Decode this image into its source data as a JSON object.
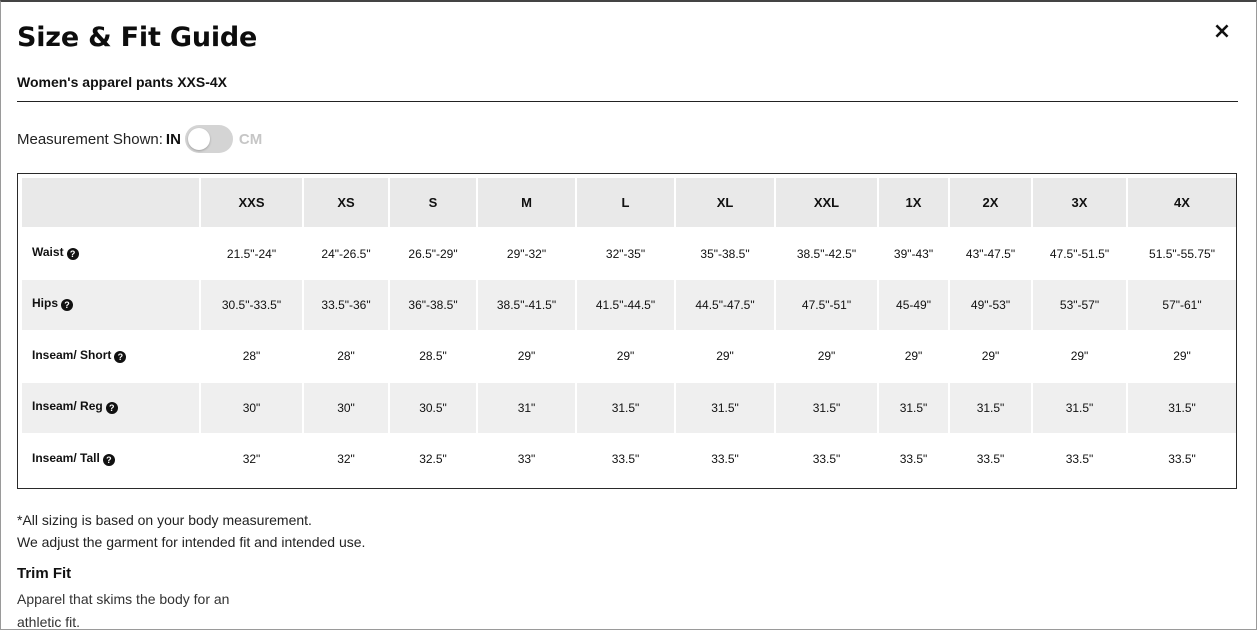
{
  "modal": {
    "title": "Size & Fit Guide",
    "close_icon": "×",
    "subtitle": "Women's apparel pants XXS-4X"
  },
  "measurement": {
    "label": "Measurement Shown:",
    "unit_in": "IN",
    "unit_cm": "CM",
    "selected": "IN"
  },
  "size_table": {
    "sizes": [
      "XXS",
      "XS",
      "S",
      "M",
      "L",
      "XL",
      "XXL",
      "1X",
      "2X",
      "3X",
      "4X"
    ],
    "rows": [
      {
        "label": "Waist",
        "values": [
          "21.5\"-24\"",
          "24\"-26.5\"",
          "26.5\"-29\"",
          "29\"-32\"",
          "32\"-35\"",
          "35\"-38.5\"",
          "38.5\"-42.5\"",
          "39\"-43\"",
          "43\"-47.5\"",
          "47.5\"-51.5\"",
          "51.5\"-55.75\""
        ]
      },
      {
        "label": "Hips",
        "values": [
          "30.5\"-33.5\"",
          "33.5\"-36\"",
          "36\"-38.5\"",
          "38.5\"-41.5\"",
          "41.5\"-44.5\"",
          "44.5\"-47.5\"",
          "47.5\"-51\"",
          "45-49\"",
          "49\"-53\"",
          "53\"-57\"",
          "57\"-61\""
        ]
      },
      {
        "label": "Inseam/ Short",
        "values": [
          "28\"",
          "28\"",
          "28.5\"",
          "29\"",
          "29\"",
          "29\"",
          "29\"",
          "29\"",
          "29\"",
          "29\"",
          "29\""
        ]
      },
      {
        "label": "Inseam/ Reg",
        "values": [
          "30\"",
          "30\"",
          "30.5\"",
          "31\"",
          "31.5\"",
          "31.5\"",
          "31.5\"",
          "31.5\"",
          "31.5\"",
          "31.5\"",
          "31.5\""
        ]
      },
      {
        "label": "Inseam/ Tall",
        "values": [
          "32\"",
          "32\"",
          "32.5\"",
          "33\"",
          "33.5\"",
          "33.5\"",
          "33.5\"",
          "33.5\"",
          "33.5\"",
          "33.5\"",
          "33.5\""
        ]
      }
    ]
  },
  "footnote": {
    "line1": "*All sizing is based on your body measurement.",
    "line2": "We adjust the garment for intended fit and intended use."
  },
  "fit": {
    "title": "Trim Fit",
    "description": "Apparel that skims the body for an athletic fit."
  },
  "icons": {
    "help": "?",
    "close": "close-icon"
  }
}
